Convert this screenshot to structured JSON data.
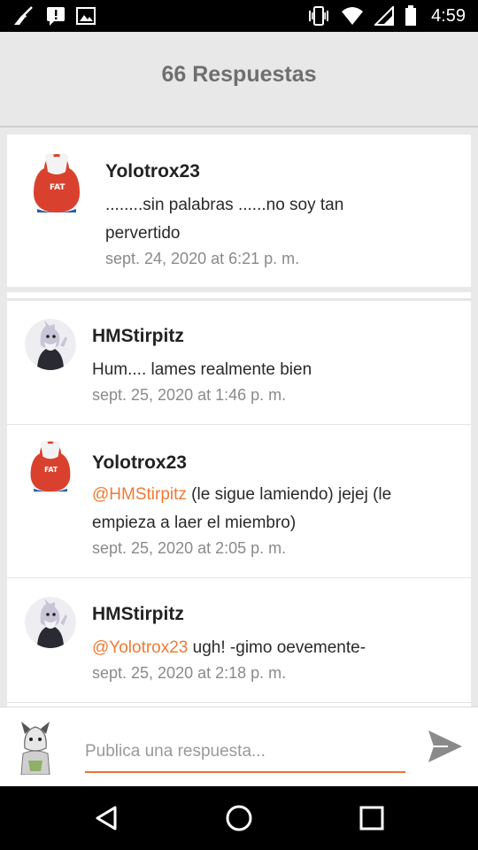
{
  "status_bar": {
    "time": "4:59",
    "left_icons": [
      "broom-icon",
      "notification-icon",
      "image-icon"
    ],
    "right_icons": [
      "vibrate-icon",
      "wifi-icon",
      "signal-icon",
      "battery-icon"
    ]
  },
  "header": {
    "title": "66 Respuestas"
  },
  "post": {
    "author": "Yolotrox23",
    "text": "........sin palabras ......no soy tan pervertido",
    "time": "sept. 24, 2020 at 6:21 p. m."
  },
  "replies": [
    {
      "author": "HMStirpitz",
      "mention": "",
      "text": "Hum.... lames realmente bien",
      "time": "sept. 25, 2020 at 1:46 p. m."
    },
    {
      "author": "Yolotrox23",
      "mention": "@HMStirpitz",
      "text": " (le sigue lamiendo)  jejej (le empieza a laer el miembro)",
      "time": "sept. 25, 2020 at 2:05 p. m."
    },
    {
      "author": "HMStirpitz",
      "mention": "@Yolotrox23",
      "text": " ugh! -gimo oevemente-",
      "time": "sept. 25, 2020 at 2:18 p. m."
    }
  ],
  "composer": {
    "placeholder": "Publica una respuesta..."
  },
  "colors": {
    "accent": "#ee7236",
    "mention": "#f07a34",
    "header_bg": "#e8e8e8",
    "avatar_red": "#d9412e"
  },
  "nav": {
    "buttons": [
      "back-icon",
      "home-icon",
      "recents-icon"
    ]
  }
}
